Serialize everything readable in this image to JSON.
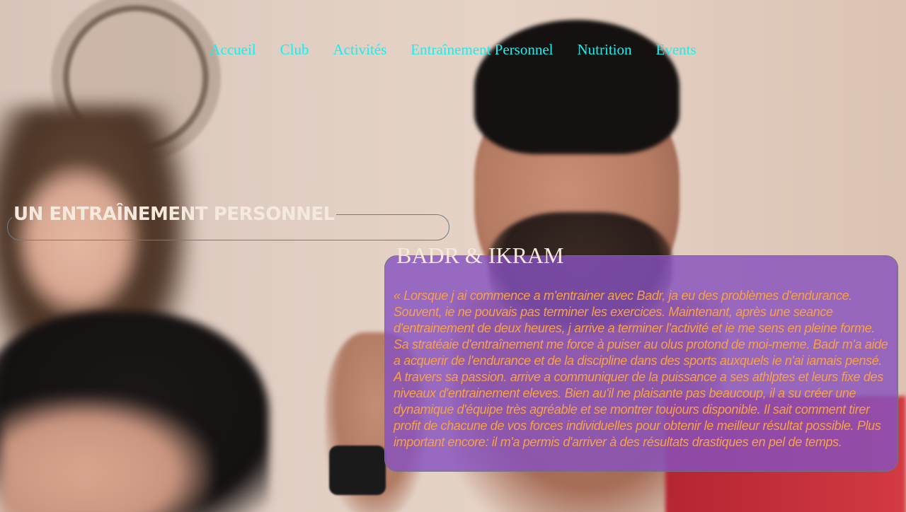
{
  "nav": {
    "items": [
      {
        "label": "Accueil"
      },
      {
        "label": "Club"
      },
      {
        "label": "Activités"
      },
      {
        "label": "Entraînement Personnel"
      },
      {
        "label": "Nutrition"
      },
      {
        "label": "Events"
      }
    ]
  },
  "hero": {
    "heading": "UN ENTRAÎNEMENT PERSONNEL"
  },
  "testimonial": {
    "author": "BADR & IKRAM",
    "quote": "« Lorsque j ai commence a m'entrainer avec Badr, ja eu des problèmes d'endurance. Souvent, ie ne pouvais pas terminer les exercices. Maintenant, après une seance d'entrainement de deux heures, j arrive a terminer l'activité et ie me sens en pleine forme. Sa stratéaie d'entraînement me force à puiser au olus protond de moi-meme. Badr m'a aide a acquerir de l'endurance et de la discipline dans des sports auxquels ie n'ai iamais pensé. A travers sa passion. arrive a communiquer de la puissance a ses athlptes et leurs fixe des niveaux d'entrainement eleves. Bien au'il ne plaisante pas beaucoup, il a su créer une dynamique d'équipe très agréable et se montrer toujours disponible. Il sait comment tirer profit de chacune de vos forces individuelles pour obtenir le meilleur résultat possible. Plus important encore: il m'a permis d'arriver à des résultats drastiques en pel de temps."
  },
  "colors": {
    "nav_link": "#13f0ef",
    "heading": "#f4e9dc",
    "quote_text": "#f7a244",
    "quote_bg": "#8652be"
  }
}
